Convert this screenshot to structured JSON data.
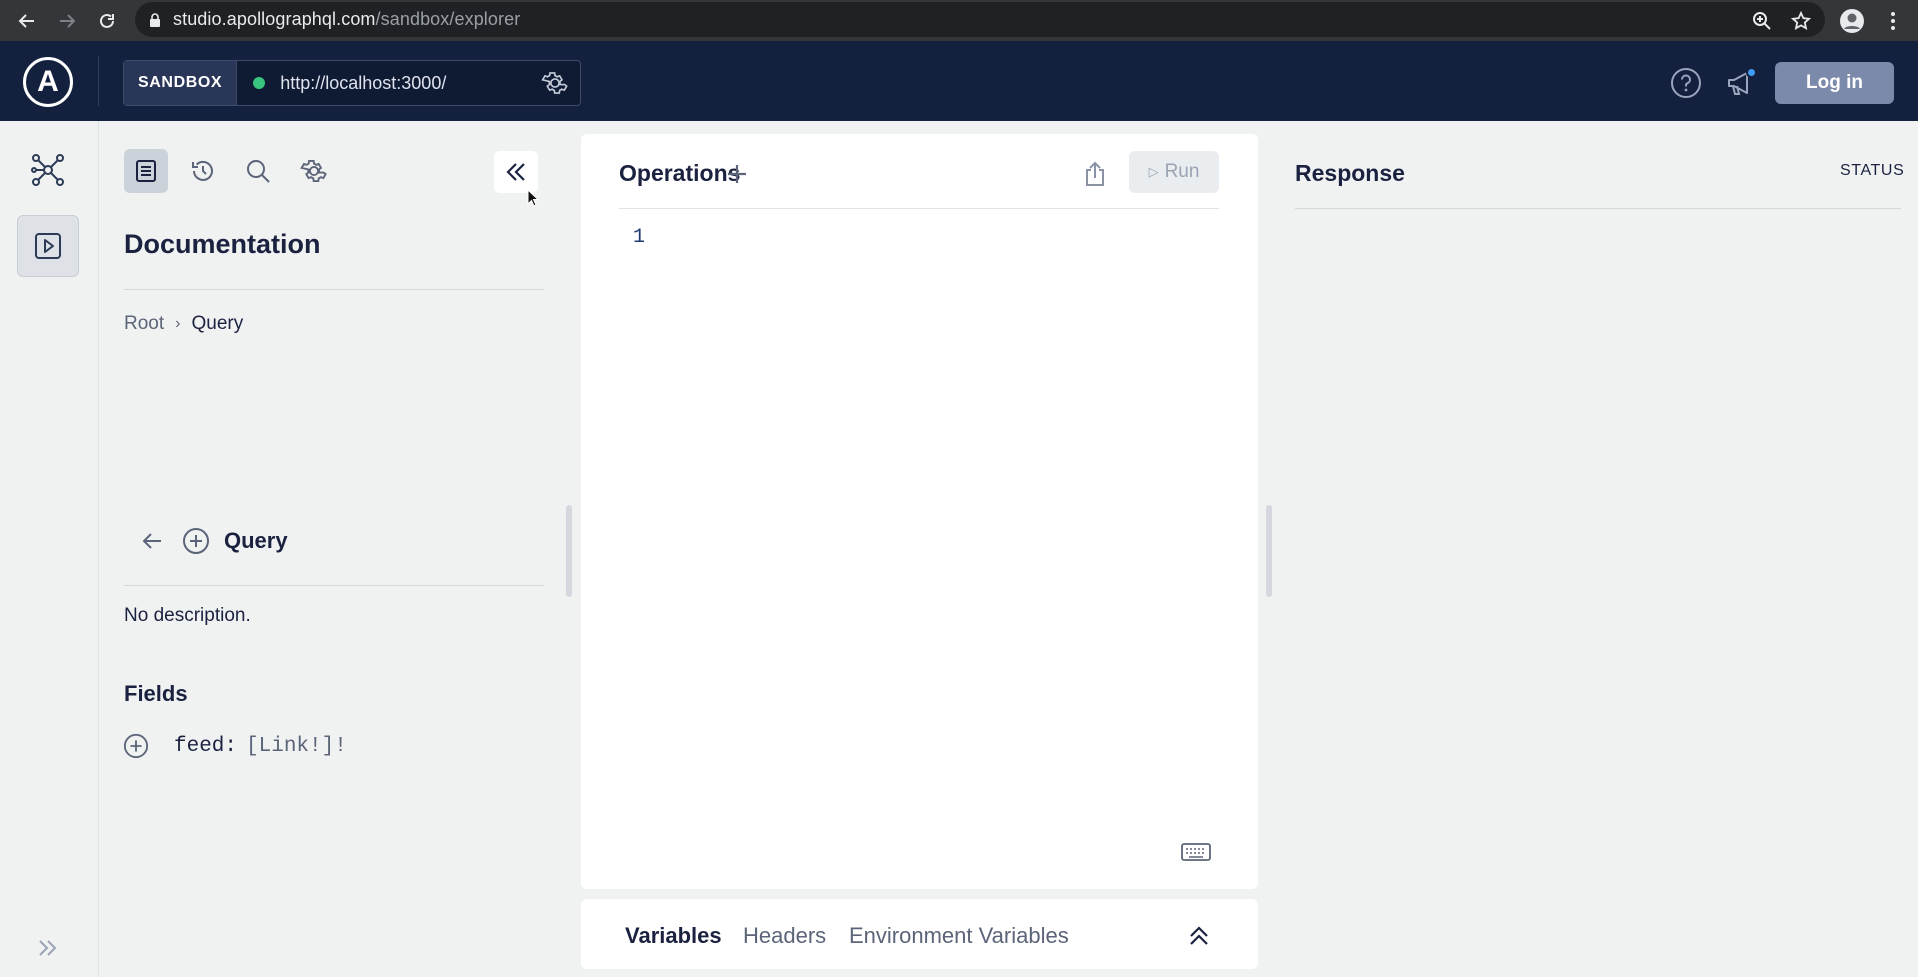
{
  "browser": {
    "url_host": "studio.apollographql.com",
    "url_path": "/sandbox/explorer"
  },
  "header": {
    "logo_letter": "A",
    "sandbox_label": "SANDBOX",
    "endpoint_url": "http://localhost:3000/",
    "login_label": "Log in",
    "status_color": "#36c47e"
  },
  "docs": {
    "title": "Documentation",
    "breadcrumb": {
      "root": "Root",
      "separator": "›",
      "current": "Query"
    },
    "type_name": "Query",
    "description": "No description.",
    "fields_heading": "Fields",
    "fields": [
      {
        "name": "feed:",
        "type": "[Link!]!"
      }
    ]
  },
  "operations": {
    "title": "Operations",
    "run_label": "Run",
    "line_numbers": [
      "1"
    ]
  },
  "variables_bar": {
    "tabs": [
      "Variables",
      "Headers",
      "Environment Variables"
    ],
    "active_tab": "Variables"
  },
  "response": {
    "title": "Response",
    "status_label": "STATUS"
  },
  "icons": {
    "rail": [
      "schema-icon",
      "explorer-play-icon",
      "expand-sidebar-icon"
    ],
    "docs_tabs": [
      "documentation-icon",
      "history-icon",
      "search-icon",
      "settings-gear-icon"
    ]
  }
}
